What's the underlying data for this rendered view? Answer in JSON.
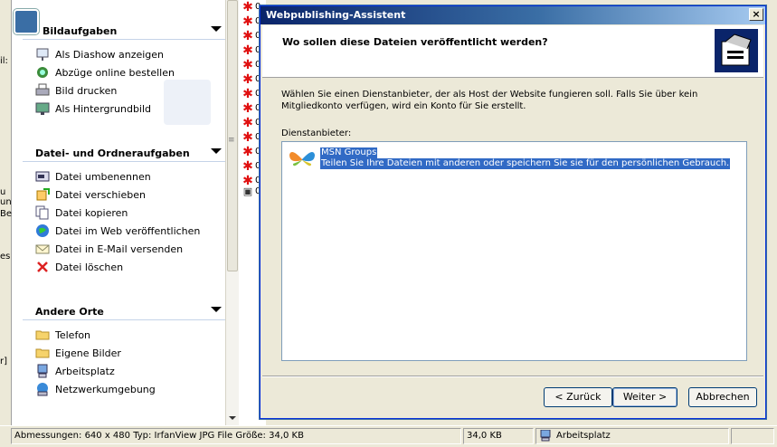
{
  "left_strip": {
    "fragments": [
      "il:",
      "u",
      "un",
      "Be",
      "es",
      "r]"
    ]
  },
  "task_pane": {
    "sections": [
      {
        "title": "Bildaufgaben",
        "items": [
          {
            "label": "Als Diashow anzeigen",
            "icon": "slideshow-icon"
          },
          {
            "label": "Abzüge online bestellen",
            "icon": "order-prints-icon"
          },
          {
            "label": "Bild drucken",
            "icon": "printer-icon"
          },
          {
            "label": "Als Hintergrundbild",
            "icon": "wallpaper-icon"
          }
        ]
      },
      {
        "title": "Datei- und Ordneraufgaben",
        "items": [
          {
            "label": "Datei umbenennen",
            "icon": "rename-icon"
          },
          {
            "label": "Datei verschieben",
            "icon": "move-icon"
          },
          {
            "label": "Datei kopieren",
            "icon": "copy-icon"
          },
          {
            "label": "Datei im Web veröffentlichen",
            "icon": "publish-web-icon"
          },
          {
            "label": "Datei in E-Mail versenden",
            "icon": "email-icon"
          },
          {
            "label": "Datei löschen",
            "icon": "delete-icon"
          }
        ]
      },
      {
        "title": "Andere Orte",
        "items": [
          {
            "label": "Telefon",
            "icon": "folder-icon"
          },
          {
            "label": "Eigene Bilder",
            "icon": "folder-icon"
          },
          {
            "label": "Arbeitsplatz",
            "icon": "computer-icon"
          },
          {
            "label": "Netzwerkumgebung",
            "icon": "network-icon"
          }
        ]
      }
    ]
  },
  "file_list": {
    "visible_char": "0"
  },
  "dialog": {
    "title": "Webpublishing-Assistent",
    "question": "Wo sollen diese Dateien veröffentlicht werden?",
    "intro": "Wählen Sie einen Dienstanbieter, der als Host der Website fungieren soll. Falls Sie über kein Mitgliedkonto verfügen, wird ein Konto für Sie erstellt.",
    "provider_label": "Dienstanbieter:",
    "providers": [
      {
        "name": "MSN Groups",
        "description": "Teilen Sie Ihre Dateien mit anderen oder speichern Sie sie für den persönlichen Gebrauch.",
        "selected": true
      }
    ],
    "buttons": {
      "back": "< Zurück",
      "next": "Weiter >",
      "cancel": "Abbrechen"
    }
  },
  "status_bar": {
    "details": "Abmessungen: 640 x 480 Typ: IrfanView JPG File Größe: 34,0 KB",
    "size": "34,0 KB",
    "location": "Arbeitsplatz"
  },
  "colors": {
    "title_bar": "#0a246a",
    "selection": "#316ac5",
    "task_pane_bg": "#ffffff"
  }
}
